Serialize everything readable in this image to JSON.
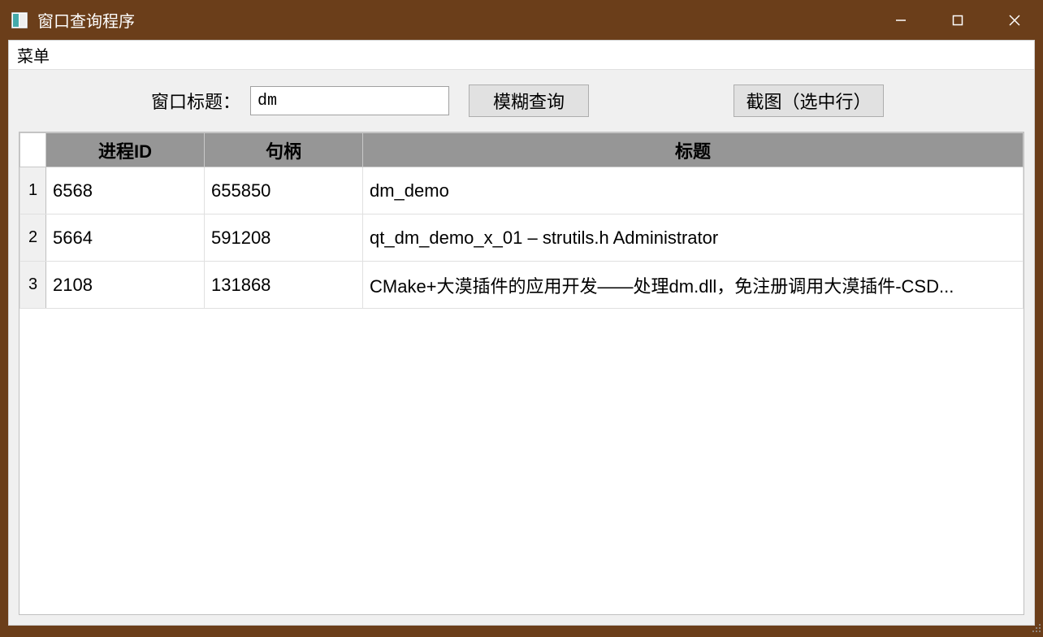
{
  "window": {
    "title": "窗口查询程序"
  },
  "menubar": {
    "menu_label": "菜单"
  },
  "toolbar": {
    "title_label": "窗口标题：",
    "title_input_value": "dm",
    "query_label": "模糊查询",
    "screenshot_label": "截图（选中行）"
  },
  "table": {
    "headers": {
      "pid": "进程ID",
      "handle": "句柄",
      "title": "标题"
    },
    "rows": [
      {
        "num": "1",
        "pid": "6568",
        "handle": "655850",
        "title": "dm_demo"
      },
      {
        "num": "2",
        "pid": "5664",
        "handle": "591208",
        "title": "qt_dm_demo_x_01 – strutils.h Administrator"
      },
      {
        "num": "3",
        "pid": "2108",
        "handle": "131868",
        "title": "CMake+大漠插件的应用开发——处理dm.dll，免注册调用大漠插件-CSD..."
      }
    ]
  }
}
